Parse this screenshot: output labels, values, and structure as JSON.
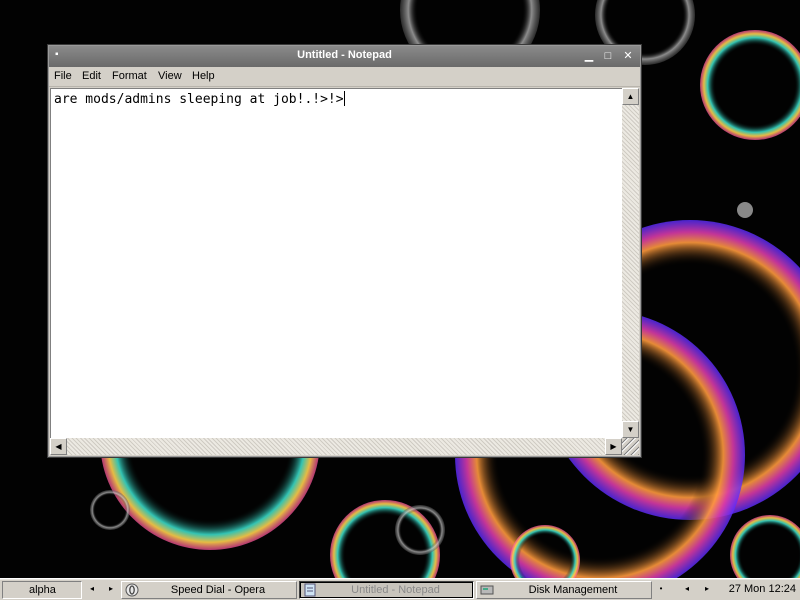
{
  "window": {
    "title": "Untitled - Notepad",
    "icon": "notepad-system-icon",
    "controls": {
      "minimize": "▁",
      "maximize": "□",
      "close": "✕"
    }
  },
  "menubar": {
    "items": [
      "File",
      "Edit",
      "Format",
      "View",
      "Help"
    ]
  },
  "editor": {
    "text": "are mods/admins sleeping at job!.!>!>"
  },
  "taskbar": {
    "desktop_name": "alpha",
    "tasks": [
      {
        "label": "Speed Dial - Opera",
        "icon": "opera-icon",
        "active": false
      },
      {
        "label": "Untitled - Notepad",
        "icon": "notepad-icon",
        "active": true
      },
      {
        "label": "Disk Management",
        "icon": "disk-management-icon",
        "active": false
      }
    ],
    "clock": "27 Mon 12:24"
  },
  "colors": {
    "titlebar": "#7a7a7a",
    "window_face": "#d4d0c8",
    "editor_bg": "#ffffff",
    "desktop_bg": "#020202"
  }
}
